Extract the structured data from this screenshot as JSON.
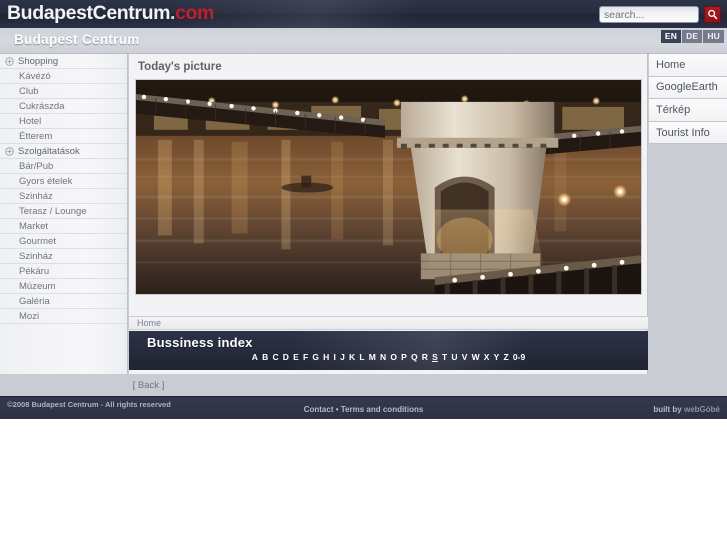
{
  "header": {
    "logo_main": "BudapestCentrum",
    "logo_dot": ".",
    "logo_tld": "com",
    "search_placeholder": "search...",
    "search_value": "",
    "search_icon": "magnifier-icon",
    "accent_red": "#a81c22"
  },
  "titlebar": {
    "title": "Budapest Centrum",
    "languages": [
      {
        "code": "EN",
        "active": true
      },
      {
        "code": "DE",
        "active": false
      },
      {
        "code": "HU",
        "active": false
      }
    ]
  },
  "sidebar": {
    "items": [
      {
        "label": "Shopping",
        "type": "parent"
      },
      {
        "label": "Kávézó",
        "type": "child"
      },
      {
        "label": "Club",
        "type": "child"
      },
      {
        "label": "Cukrászda",
        "type": "child"
      },
      {
        "label": "Hotel",
        "type": "child"
      },
      {
        "label": "Étterem",
        "type": "child"
      },
      {
        "label": "Szolgáltatások",
        "type": "parent"
      },
      {
        "label": "Bár/Pub",
        "type": "child"
      },
      {
        "label": "Gyors ételek",
        "type": "child"
      },
      {
        "label": "Szinház",
        "type": "child"
      },
      {
        "label": "Terasz / Lounge",
        "type": "child"
      },
      {
        "label": "Market",
        "type": "child"
      },
      {
        "label": "Gourmet",
        "type": "child"
      },
      {
        "label": "Szinház",
        "type": "child"
      },
      {
        "label": "Pékáru",
        "type": "child"
      },
      {
        "label": "Múzeum",
        "type": "child"
      },
      {
        "label": "Galéria",
        "type": "child"
      },
      {
        "label": "Mozi",
        "type": "child"
      }
    ]
  },
  "main": {
    "photo_heading": "Today's picture",
    "photo_alt": "Széchenyi Chain Bridge illuminated at night over the Danube",
    "breadcrumb": "Home",
    "index_title": "Bussiness index",
    "alphabet": [
      "A",
      "B",
      "C",
      "D",
      "E",
      "F",
      "G",
      "H",
      "I",
      "J",
      "K",
      "L",
      "M",
      "N",
      "O",
      "P",
      "Q",
      "R",
      "S",
      "T",
      "U",
      "V",
      "W",
      "X",
      "Y",
      "Z",
      "0-9"
    ]
  },
  "rightnav": {
    "items": [
      {
        "label": "Home"
      },
      {
        "label": "GoogleEarth"
      },
      {
        "label": "Térkép"
      },
      {
        "label": "Tourist Info"
      }
    ]
  },
  "back": {
    "label": "[ Back ]"
  },
  "footer": {
    "copyright": "©2008 Budapest Centrum - All rights reserved",
    "contact": "Contact",
    "separator": "•",
    "terms": "Terms and conditions",
    "built_by": "built by ",
    "builder": "webGóbé"
  }
}
